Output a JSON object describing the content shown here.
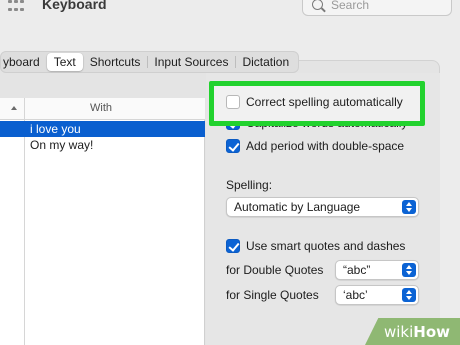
{
  "window": {
    "title": "Keyboard",
    "search_placeholder": "Search"
  },
  "tabs": [
    {
      "label": "yboard"
    },
    {
      "label": "Text",
      "selected": true
    },
    {
      "label": "Shortcuts"
    },
    {
      "label": "Input Sources"
    },
    {
      "label": "Dictation"
    }
  ],
  "table": {
    "header_with": "With",
    "rows": [
      {
        "with": "i love you",
        "selected": true
      },
      {
        "with": "On my way!"
      }
    ]
  },
  "options": {
    "correct_spelling": {
      "label": "Correct spelling automatically",
      "checked": false
    },
    "capitalize_words": {
      "label": "Capitalize words automatically",
      "checked": true
    },
    "add_period": {
      "label": "Add period with double-space",
      "checked": true
    },
    "spelling_label": "Spelling:",
    "spelling_value": "Automatic by Language",
    "smart_quotes": {
      "label": "Use smart quotes and dashes",
      "checked": true
    },
    "double_quotes_label": "for Double Quotes",
    "double_quotes_value": "“abc”",
    "single_quotes_label": "for Single Quotes",
    "single_quotes_value": "‘abc’"
  },
  "watermark": {
    "wiki": "wiki",
    "how": "How"
  },
  "colors": {
    "accent": "#0b63d4",
    "highlight": "#22d22e",
    "selection": "#0a5fcf"
  }
}
